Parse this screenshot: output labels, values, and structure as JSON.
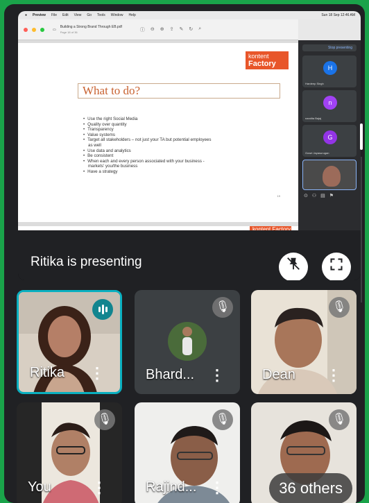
{
  "mac_menubar": {
    "app": "Preview",
    "menus": [
      "File",
      "Edit",
      "View",
      "Go",
      "Tools",
      "Window",
      "Help"
    ],
    "clock": "Sun 18 Sep 12:46 AM"
  },
  "pdf": {
    "title": "Building a Strong Brand Through EB.pdf",
    "subtitle": "Page 18 of 36",
    "slide_title": "What to do?",
    "logo_line1": "kontent",
    "logo_line2": "Factory",
    "bullets": [
      "Use the right Social Media",
      "Quality over quantity",
      "Transparency",
      "Value systems",
      "Target all stakeholders – not just your TA but potential employees",
      "as well",
      "Use data and analytics",
      "Be consistent",
      "When each and every person associated with your business  -",
      "markets' you/the business",
      "Have a strategy"
    ],
    "page_number": "19",
    "next_logo": "kontent Factory"
  },
  "meet_sidebar": {
    "stop_label": "Stop presenting",
    "participants": [
      {
        "initial": "H",
        "name": "Hardeep Singh",
        "color": "#1a73e8"
      },
      {
        "initial": "n",
        "name": "nandita Bajaj",
        "color": "#a142f4"
      },
      {
        "initial": "G",
        "name": "Gowri Jayasurugan",
        "color": "#9334e6"
      }
    ],
    "self_label": "Ritika Sharma"
  },
  "presentation": {
    "label": "Ritika is presenting"
  },
  "tiles": [
    {
      "name": "Ritika",
      "state": "speaking"
    },
    {
      "name": "Bhard...",
      "state": "muted"
    },
    {
      "name": "Dean",
      "state": "muted"
    },
    {
      "name": "You",
      "state": "muted"
    },
    {
      "name": "Rajind...",
      "state": "muted"
    },
    {
      "name": "",
      "state": "muted"
    }
  ],
  "others_count": "36 others",
  "colors": {
    "outer_border": "#1aa34a",
    "meet_bg": "#202124",
    "tile_bg": "#3c4043",
    "speaking_accent": "#0ab0c0",
    "slide_accent": "#e8562a"
  }
}
